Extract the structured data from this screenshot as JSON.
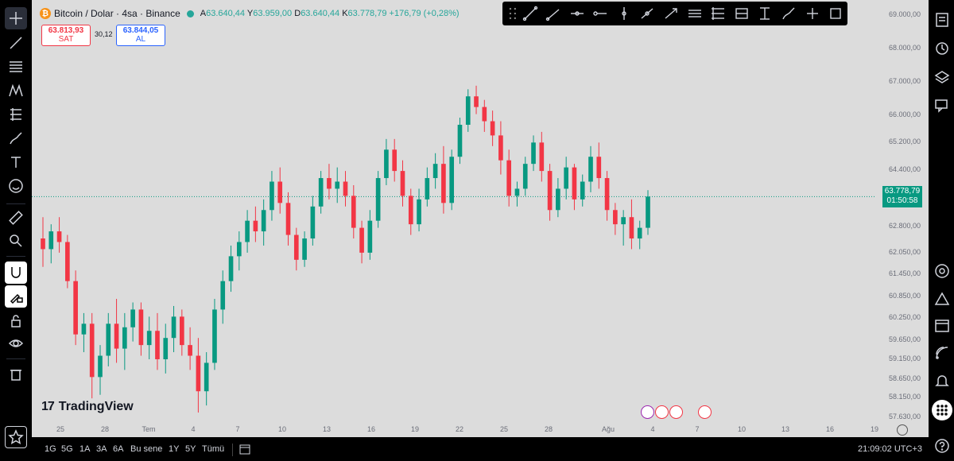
{
  "symbol": {
    "title": "Bitcoin / Dolar · 4sa · Binance",
    "btc_glyph": "₿"
  },
  "ohlc": {
    "open_key": "A",
    "open": "63.640,44",
    "high_key": "Y",
    "high": "63.959,00",
    "low_key": "D",
    "low": "63.640,44",
    "close_key": "K",
    "close": "63.778,79",
    "change": "+176,79 (+0,28%)"
  },
  "trade": {
    "sell_price": "63.813,93",
    "sell_label": "SAT",
    "spread": "30,12",
    "buy_price": "63.844,05",
    "buy_label": "AL"
  },
  "price_axis": {
    "labels": [
      "69.000,00",
      "68.000,00",
      "67.000,00",
      "66.000,00",
      "65.200,00",
      "64.400,00",
      "62.800,00",
      "62.050,00",
      "61.450,00",
      "60.850,00",
      "60.250,00",
      "59.650,00",
      "59.150,00",
      "58.650,00",
      "58.150,00",
      "57.630,00"
    ],
    "last_price": "63.778,79",
    "countdown": "01:50:58"
  },
  "time_axis": {
    "labels": [
      "25",
      "28",
      "Tem",
      "4",
      "7",
      "10",
      "13",
      "16",
      "19",
      "22",
      "25",
      "28",
      "Ağu",
      "4",
      "7",
      "10",
      "13",
      "16",
      "19"
    ]
  },
  "logo": {
    "text": "TradingView",
    "mark": "17"
  },
  "bottom": {
    "ranges": [
      "1G",
      "5G",
      "1A",
      "3A",
      "6A",
      "Bu sene",
      "1Y",
      "5Y",
      "Tümü"
    ],
    "clock": "21:09:02 UTC+3"
  },
  "colors": {
    "up": "#089981",
    "down": "#f23645",
    "background": "#dcdcdc"
  },
  "icons": {
    "left_toolbar": [
      "crosshair-icon",
      "trend-line-icon",
      "fib-icon",
      "pattern-icon",
      "forecast-icon",
      "brush-icon",
      "text-icon",
      "emoji-icon",
      "ruler-icon",
      "zoom-icon",
      "magnet-icon",
      "lock-draw-icon",
      "lock-icon",
      "eye-icon",
      "trash-icon",
      "star-icon"
    ],
    "right_toolbar": [
      "watchlist-icon",
      "alerts-clock-icon",
      "layers-icon",
      "chat-icon",
      "target-icon",
      "ideas-icon",
      "calendar-icon",
      "news-icon",
      "notifications-icon",
      "apps-grid-icon",
      "help-icon"
    ],
    "draw_toolbar": [
      "trend-line-icon",
      "ray-icon",
      "horizontal-ray-icon",
      "horizontal-line-icon",
      "vertical-line-icon",
      "cross-line-icon",
      "arrow-icon",
      "channel-icon",
      "fib-retracement-icon",
      "gann-icon",
      "price-range-icon",
      "brush-icon",
      "crosshair-plus-icon",
      "rectangle-icon"
    ]
  },
  "chart_data": {
    "type": "candlestick",
    "y_axis_range": [
      57500,
      69200
    ],
    "candles": [
      {
        "o": 62600,
        "h": 63200,
        "l": 61800,
        "c": 62300
      },
      {
        "o": 62300,
        "h": 63000,
        "l": 61900,
        "c": 62800
      },
      {
        "o": 62800,
        "h": 63200,
        "l": 62200,
        "c": 62500
      },
      {
        "o": 62500,
        "h": 62700,
        "l": 61200,
        "c": 61400
      },
      {
        "o": 61400,
        "h": 61700,
        "l": 59600,
        "c": 59900
      },
      {
        "o": 59900,
        "h": 60500,
        "l": 59400,
        "c": 60200
      },
      {
        "o": 60200,
        "h": 60500,
        "l": 58100,
        "c": 58700
      },
      {
        "o": 58700,
        "h": 59600,
        "l": 58200,
        "c": 59300
      },
      {
        "o": 59300,
        "h": 60500,
        "l": 59000,
        "c": 60200
      },
      {
        "o": 60200,
        "h": 60900,
        "l": 59100,
        "c": 59500
      },
      {
        "o": 59500,
        "h": 60500,
        "l": 58900,
        "c": 60100
      },
      {
        "o": 60100,
        "h": 60800,
        "l": 59700,
        "c": 60600
      },
      {
        "o": 60600,
        "h": 60800,
        "l": 59300,
        "c": 59600
      },
      {
        "o": 59600,
        "h": 60400,
        "l": 59200,
        "c": 60000
      },
      {
        "o": 60000,
        "h": 60500,
        "l": 58900,
        "c": 59200
      },
      {
        "o": 59200,
        "h": 60200,
        "l": 58800,
        "c": 59800
      },
      {
        "o": 59800,
        "h": 60700,
        "l": 59400,
        "c": 60400
      },
      {
        "o": 60400,
        "h": 60600,
        "l": 59300,
        "c": 59600
      },
      {
        "o": 59600,
        "h": 60100,
        "l": 58900,
        "c": 59300
      },
      {
        "o": 59300,
        "h": 59800,
        "l": 57700,
        "c": 58300
      },
      {
        "o": 58300,
        "h": 59400,
        "l": 57900,
        "c": 59100
      },
      {
        "o": 59100,
        "h": 60900,
        "l": 58900,
        "c": 60600
      },
      {
        "o": 60600,
        "h": 61700,
        "l": 60200,
        "c": 61400
      },
      {
        "o": 61400,
        "h": 62400,
        "l": 61100,
        "c": 62100
      },
      {
        "o": 62100,
        "h": 62800,
        "l": 61700,
        "c": 62500
      },
      {
        "o": 62500,
        "h": 63400,
        "l": 62200,
        "c": 63100
      },
      {
        "o": 63100,
        "h": 63500,
        "l": 62500,
        "c": 62800
      },
      {
        "o": 62800,
        "h": 63700,
        "l": 62400,
        "c": 63400
      },
      {
        "o": 63400,
        "h": 64500,
        "l": 63100,
        "c": 64200
      },
      {
        "o": 64200,
        "h": 64600,
        "l": 63300,
        "c": 63600
      },
      {
        "o": 63600,
        "h": 63900,
        "l": 62400,
        "c": 62700
      },
      {
        "o": 62700,
        "h": 62900,
        "l": 61700,
        "c": 62000
      },
      {
        "o": 62000,
        "h": 62800,
        "l": 61800,
        "c": 62600
      },
      {
        "o": 62600,
        "h": 63800,
        "l": 62400,
        "c": 63500
      },
      {
        "o": 63500,
        "h": 64500,
        "l": 63300,
        "c": 64300
      },
      {
        "o": 64300,
        "h": 64700,
        "l": 63700,
        "c": 64000
      },
      {
        "o": 64000,
        "h": 64600,
        "l": 63600,
        "c": 64200
      },
      {
        "o": 64200,
        "h": 64500,
        "l": 63500,
        "c": 63800
      },
      {
        "o": 63800,
        "h": 64100,
        "l": 62600,
        "c": 62900
      },
      {
        "o": 62900,
        "h": 63100,
        "l": 61900,
        "c": 62200
      },
      {
        "o": 62200,
        "h": 63400,
        "l": 62000,
        "c": 63100
      },
      {
        "o": 63100,
        "h": 64500,
        "l": 62900,
        "c": 64300
      },
      {
        "o": 64300,
        "h": 65400,
        "l": 64100,
        "c": 65100
      },
      {
        "o": 65100,
        "h": 65400,
        "l": 64200,
        "c": 64500
      },
      {
        "o": 64500,
        "h": 64800,
        "l": 63500,
        "c": 63800
      },
      {
        "o": 63800,
        "h": 64000,
        "l": 62700,
        "c": 63000
      },
      {
        "o": 63000,
        "h": 64000,
        "l": 62800,
        "c": 63700
      },
      {
        "o": 63700,
        "h": 64600,
        "l": 63500,
        "c": 64300
      },
      {
        "o": 64300,
        "h": 65000,
        "l": 64000,
        "c": 64700
      },
      {
        "o": 64700,
        "h": 65200,
        "l": 63300,
        "c": 63600
      },
      {
        "o": 63600,
        "h": 65100,
        "l": 63400,
        "c": 64900
      },
      {
        "o": 64900,
        "h": 66000,
        "l": 64700,
        "c": 65800
      },
      {
        "o": 65800,
        "h": 66800,
        "l": 65600,
        "c": 66600
      },
      {
        "o": 66600,
        "h": 66900,
        "l": 66100,
        "c": 66300
      },
      {
        "o": 66300,
        "h": 66500,
        "l": 65600,
        "c": 65900
      },
      {
        "o": 65900,
        "h": 66200,
        "l": 65200,
        "c": 65500
      },
      {
        "o": 65500,
        "h": 65900,
        "l": 64400,
        "c": 64800
      },
      {
        "o": 64800,
        "h": 65100,
        "l": 63500,
        "c": 63800
      },
      {
        "o": 63800,
        "h": 64200,
        "l": 63500,
        "c": 64000
      },
      {
        "o": 64000,
        "h": 64900,
        "l": 63800,
        "c": 64700
      },
      {
        "o": 64700,
        "h": 65500,
        "l": 64500,
        "c": 65300
      },
      {
        "o": 65300,
        "h": 65600,
        "l": 64200,
        "c": 64500
      },
      {
        "o": 64500,
        "h": 64700,
        "l": 63100,
        "c": 63400
      },
      {
        "o": 63400,
        "h": 64300,
        "l": 63200,
        "c": 64000
      },
      {
        "o": 64000,
        "h": 64900,
        "l": 63700,
        "c": 64600
      },
      {
        "o": 64600,
        "h": 64700,
        "l": 63400,
        "c": 63700
      },
      {
        "o": 63700,
        "h": 64400,
        "l": 63500,
        "c": 64200
      },
      {
        "o": 64200,
        "h": 65200,
        "l": 63900,
        "c": 64900
      },
      {
        "o": 64900,
        "h": 65300,
        "l": 64000,
        "c": 64300
      },
      {
        "o": 64300,
        "h": 64500,
        "l": 63100,
        "c": 63400
      },
      {
        "o": 63400,
        "h": 63600,
        "l": 62700,
        "c": 63000
      },
      {
        "o": 63000,
        "h": 63400,
        "l": 62400,
        "c": 63200
      },
      {
        "o": 63200,
        "h": 63700,
        "l": 62300,
        "c": 62600
      },
      {
        "o": 62600,
        "h": 63100,
        "l": 62300,
        "c": 62900
      },
      {
        "o": 62900,
        "h": 63960,
        "l": 62700,
        "c": 63779
      }
    ]
  }
}
